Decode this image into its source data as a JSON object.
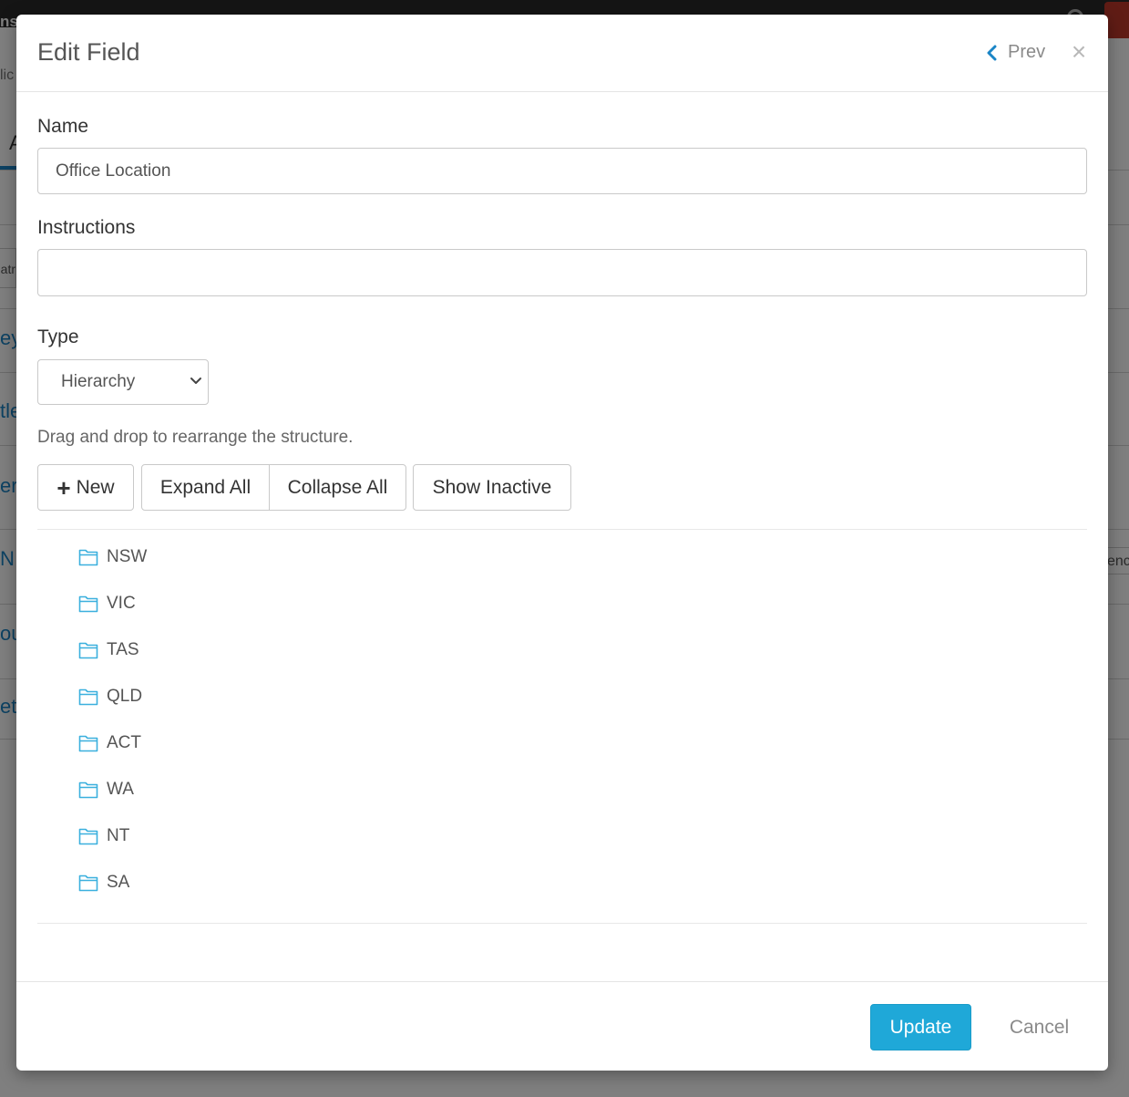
{
  "background": {
    "topbar_text": "ns",
    "left_fragments": [
      "lic",
      "A",
      "atr",
      "ey",
      "tle",
      "er",
      "N",
      "ou",
      "et"
    ],
    "right_fragment": "enc"
  },
  "modal": {
    "title": "Edit Field",
    "prev_label": "Prev",
    "close_glyph": "×",
    "icons": {
      "prev": "chevron-left-icon",
      "close": "close-icon",
      "select": "chevron-down-icon",
      "node": "folder-icon",
      "new": "plus-icon"
    },
    "accent_color": "#1fa8d8",
    "folder_color": "#3bb0de"
  },
  "form": {
    "name_label": "Name",
    "name_value": "Office Location",
    "instructions_label": "Instructions",
    "instructions_value": "",
    "type_label": "Type",
    "type_value": "Hierarchy",
    "hint": "Drag and drop to rearrange the structure."
  },
  "toolbar": {
    "new_plus": "+",
    "new_label": "New",
    "expand_label": "Expand All",
    "collapse_label": "Collapse All",
    "inactive_label": "Show Inactive"
  },
  "tree": {
    "nodes": [
      "NSW",
      "VIC",
      "TAS",
      "QLD",
      "ACT",
      "WA",
      "NT",
      "SA"
    ]
  },
  "footer": {
    "update_label": "Update",
    "cancel_label": "Cancel"
  }
}
